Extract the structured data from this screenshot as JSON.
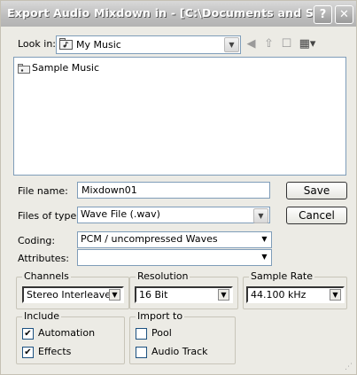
{
  "window": {
    "title": "Export Audio Mixdown in - [C:\\Documents and Settings\\y...",
    "help_button": "?",
    "close_button": "✕"
  },
  "look_in": {
    "label": "Look in:",
    "value": "My Music"
  },
  "files": [
    {
      "name": "Sample Music"
    }
  ],
  "form": {
    "file_name_label": "File name:",
    "file_name_value": "Mixdown01",
    "files_of_type_label": "Files of type:",
    "files_of_type_value": "Wave File (.wav)",
    "coding_label": "Coding:",
    "coding_value": "PCM / uncompressed Waves",
    "attributes_label": "Attributes:",
    "attributes_value": "",
    "save_button": "Save",
    "cancel_button": "Cancel"
  },
  "channels": {
    "title": "Channels",
    "value": "Stereo Interleaved"
  },
  "resolution": {
    "title": "Resolution",
    "value": "16 Bit"
  },
  "sample_rate": {
    "title": "Sample Rate",
    "value": "44.100 kHz"
  },
  "include": {
    "title": "Include",
    "items": [
      {
        "label": "Automation",
        "checked": true
      },
      {
        "label": "Effects",
        "checked": true
      }
    ]
  },
  "import_to": {
    "title": "Import to",
    "items": [
      {
        "label": "Pool",
        "checked": false
      },
      {
        "label": "Audio Track",
        "checked": false
      }
    ]
  },
  "colors": {
    "title_text": "#ffffff",
    "dialog_bg": "#ecebe5",
    "field_border": "#7f9db9"
  }
}
